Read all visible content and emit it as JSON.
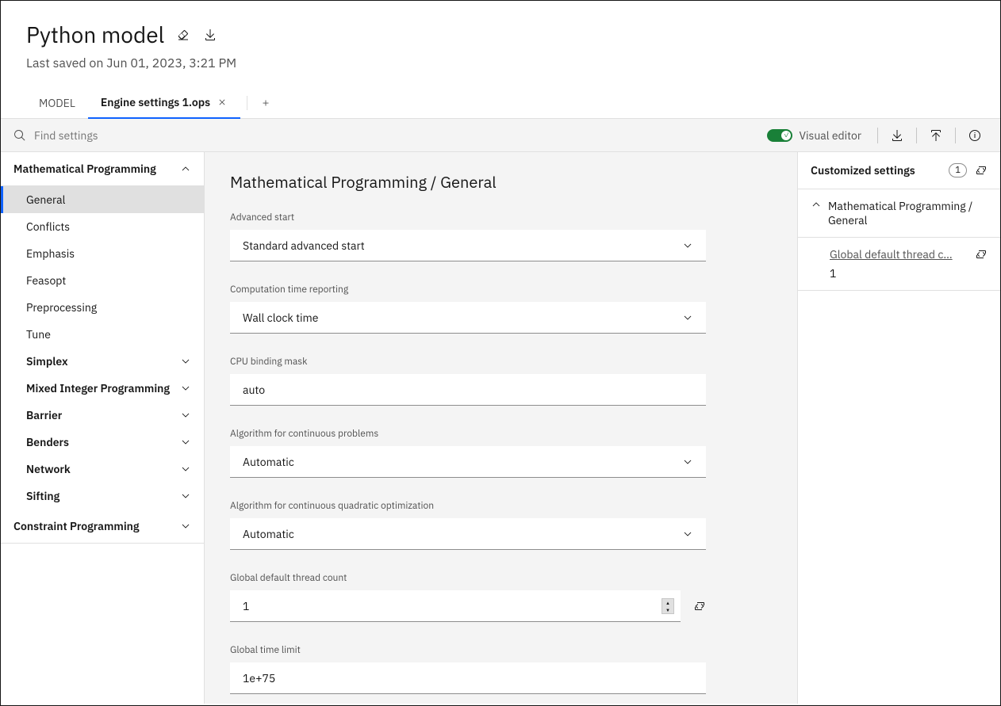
{
  "header": {
    "title": "Python model",
    "saved": "Last saved on Jun 01, 2023, 3:21 PM"
  },
  "tabs": {
    "model": "MODEL",
    "active": "Engine settings 1.ops"
  },
  "toolbar": {
    "search_placeholder": "Find settings",
    "toggle_label": "Visual editor"
  },
  "sidebar": {
    "group_math": "Mathematical Programming",
    "items": [
      "General",
      "Conflicts",
      "Emphasis",
      "Feasopt",
      "Preprocessing",
      "Tune"
    ],
    "subgroups": [
      "Simplex",
      "Mixed Integer Programming",
      "Barrier",
      "Benders",
      "Network",
      "Sifting"
    ],
    "group_constraint": "Constraint Programming"
  },
  "content": {
    "breadcrumb": "Mathematical Programming / General",
    "fields": {
      "advanced_start": {
        "label": "Advanced start",
        "value": "Standard advanced start"
      },
      "comp_time": {
        "label": "Computation time reporting",
        "value": "Wall clock time"
      },
      "cpu_mask": {
        "label": "CPU binding mask",
        "value": "auto"
      },
      "algo_cont": {
        "label": "Algorithm for continuous problems",
        "value": "Automatic"
      },
      "algo_quad": {
        "label": "Algorithm for continuous quadratic optimization",
        "value": "Automatic"
      },
      "thread_count": {
        "label": "Global default thread count",
        "value": "1"
      },
      "time_limit": {
        "label": "Global time limit",
        "value": "1e+75"
      }
    }
  },
  "right": {
    "title": "Customized settings",
    "count": "1",
    "group": "Mathematical Programming / General",
    "item_name": "Global default thread c…",
    "item_value": "1"
  }
}
